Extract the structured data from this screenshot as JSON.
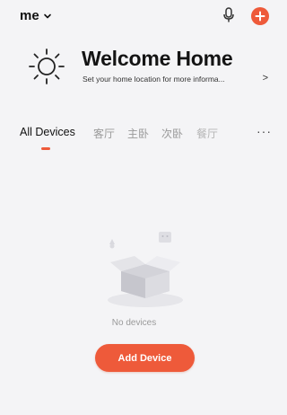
{
  "header": {
    "home_name": "me",
    "colors": {
      "accent": "#ee5a3a"
    }
  },
  "welcome": {
    "title": "Welcome Home",
    "subtitle": "Set your home location for more informa...",
    "arrow": ">"
  },
  "tabs": [
    {
      "label": "All Devices",
      "active": true
    },
    {
      "label": "客厅",
      "active": false
    },
    {
      "label": "主卧",
      "active": false
    },
    {
      "label": "次卧",
      "active": false
    },
    {
      "label": "餐厅",
      "active": false
    }
  ],
  "tabs_more": "···",
  "empty_state": {
    "message": "No devices",
    "button_label": "Add Device"
  }
}
